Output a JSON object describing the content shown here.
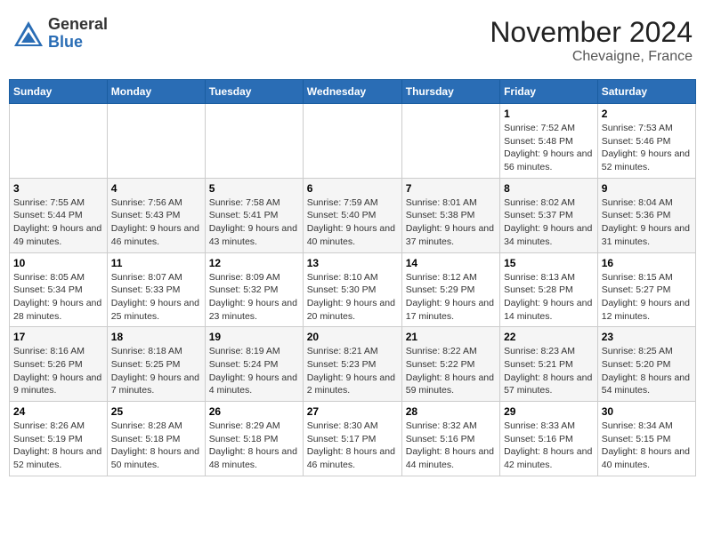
{
  "header": {
    "logo": {
      "general": "General",
      "blue": "Blue"
    },
    "month_title": "November 2024",
    "location": "Chevaigne, France"
  },
  "calendar": {
    "weekdays": [
      "Sunday",
      "Monday",
      "Tuesday",
      "Wednesday",
      "Thursday",
      "Friday",
      "Saturday"
    ],
    "weeks": [
      [
        {
          "day": "",
          "info": ""
        },
        {
          "day": "",
          "info": ""
        },
        {
          "day": "",
          "info": ""
        },
        {
          "day": "",
          "info": ""
        },
        {
          "day": "",
          "info": ""
        },
        {
          "day": "1",
          "info": "Sunrise: 7:52 AM\nSunset: 5:48 PM\nDaylight: 9 hours and 56 minutes."
        },
        {
          "day": "2",
          "info": "Sunrise: 7:53 AM\nSunset: 5:46 PM\nDaylight: 9 hours and 52 minutes."
        }
      ],
      [
        {
          "day": "3",
          "info": "Sunrise: 7:55 AM\nSunset: 5:44 PM\nDaylight: 9 hours and 49 minutes."
        },
        {
          "day": "4",
          "info": "Sunrise: 7:56 AM\nSunset: 5:43 PM\nDaylight: 9 hours and 46 minutes."
        },
        {
          "day": "5",
          "info": "Sunrise: 7:58 AM\nSunset: 5:41 PM\nDaylight: 9 hours and 43 minutes."
        },
        {
          "day": "6",
          "info": "Sunrise: 7:59 AM\nSunset: 5:40 PM\nDaylight: 9 hours and 40 minutes."
        },
        {
          "day": "7",
          "info": "Sunrise: 8:01 AM\nSunset: 5:38 PM\nDaylight: 9 hours and 37 minutes."
        },
        {
          "day": "8",
          "info": "Sunrise: 8:02 AM\nSunset: 5:37 PM\nDaylight: 9 hours and 34 minutes."
        },
        {
          "day": "9",
          "info": "Sunrise: 8:04 AM\nSunset: 5:36 PM\nDaylight: 9 hours and 31 minutes."
        }
      ],
      [
        {
          "day": "10",
          "info": "Sunrise: 8:05 AM\nSunset: 5:34 PM\nDaylight: 9 hours and 28 minutes."
        },
        {
          "day": "11",
          "info": "Sunrise: 8:07 AM\nSunset: 5:33 PM\nDaylight: 9 hours and 25 minutes."
        },
        {
          "day": "12",
          "info": "Sunrise: 8:09 AM\nSunset: 5:32 PM\nDaylight: 9 hours and 23 minutes."
        },
        {
          "day": "13",
          "info": "Sunrise: 8:10 AM\nSunset: 5:30 PM\nDaylight: 9 hours and 20 minutes."
        },
        {
          "day": "14",
          "info": "Sunrise: 8:12 AM\nSunset: 5:29 PM\nDaylight: 9 hours and 17 minutes."
        },
        {
          "day": "15",
          "info": "Sunrise: 8:13 AM\nSunset: 5:28 PM\nDaylight: 9 hours and 14 minutes."
        },
        {
          "day": "16",
          "info": "Sunrise: 8:15 AM\nSunset: 5:27 PM\nDaylight: 9 hours and 12 minutes."
        }
      ],
      [
        {
          "day": "17",
          "info": "Sunrise: 8:16 AM\nSunset: 5:26 PM\nDaylight: 9 hours and 9 minutes."
        },
        {
          "day": "18",
          "info": "Sunrise: 8:18 AM\nSunset: 5:25 PM\nDaylight: 9 hours and 7 minutes."
        },
        {
          "day": "19",
          "info": "Sunrise: 8:19 AM\nSunset: 5:24 PM\nDaylight: 9 hours and 4 minutes."
        },
        {
          "day": "20",
          "info": "Sunrise: 8:21 AM\nSunset: 5:23 PM\nDaylight: 9 hours and 2 minutes."
        },
        {
          "day": "21",
          "info": "Sunrise: 8:22 AM\nSunset: 5:22 PM\nDaylight: 8 hours and 59 minutes."
        },
        {
          "day": "22",
          "info": "Sunrise: 8:23 AM\nSunset: 5:21 PM\nDaylight: 8 hours and 57 minutes."
        },
        {
          "day": "23",
          "info": "Sunrise: 8:25 AM\nSunset: 5:20 PM\nDaylight: 8 hours and 54 minutes."
        }
      ],
      [
        {
          "day": "24",
          "info": "Sunrise: 8:26 AM\nSunset: 5:19 PM\nDaylight: 8 hours and 52 minutes."
        },
        {
          "day": "25",
          "info": "Sunrise: 8:28 AM\nSunset: 5:18 PM\nDaylight: 8 hours and 50 minutes."
        },
        {
          "day": "26",
          "info": "Sunrise: 8:29 AM\nSunset: 5:18 PM\nDaylight: 8 hours and 48 minutes."
        },
        {
          "day": "27",
          "info": "Sunrise: 8:30 AM\nSunset: 5:17 PM\nDaylight: 8 hours and 46 minutes."
        },
        {
          "day": "28",
          "info": "Sunrise: 8:32 AM\nSunset: 5:16 PM\nDaylight: 8 hours and 44 minutes."
        },
        {
          "day": "29",
          "info": "Sunrise: 8:33 AM\nSunset: 5:16 PM\nDaylight: 8 hours and 42 minutes."
        },
        {
          "day": "30",
          "info": "Sunrise: 8:34 AM\nSunset: 5:15 PM\nDaylight: 8 hours and 40 minutes."
        }
      ]
    ]
  }
}
